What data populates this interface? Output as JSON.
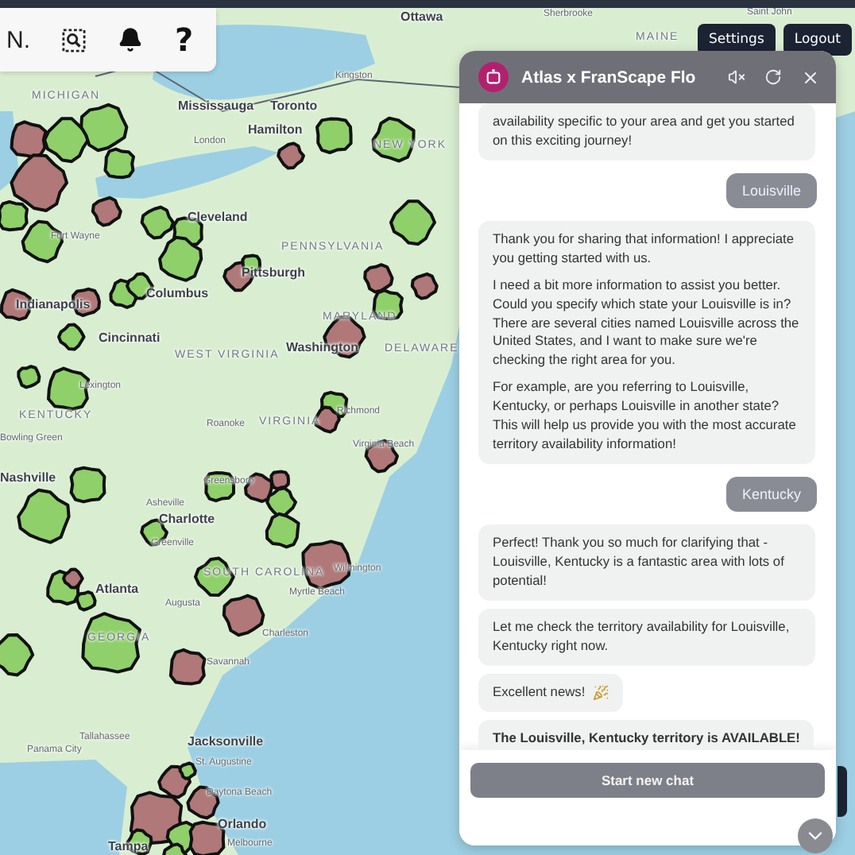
{
  "toolbar": {
    "label": "N.",
    "help": "?"
  },
  "top_buttons": [
    {
      "label": "Settings"
    },
    {
      "label": "Logout"
    }
  ],
  "map": {
    "labels": [
      {
        "text": "Ottawa",
        "kind": "city"
      },
      {
        "text": "Sherbrooke",
        "kind": "town"
      },
      {
        "text": "MAINE",
        "kind": "state"
      },
      {
        "text": "Saint John",
        "kind": "town"
      },
      {
        "text": "MICHIGAN",
        "kind": "state"
      },
      {
        "text": "Kingston",
        "kind": "town"
      },
      {
        "text": "Mississauga",
        "kind": "city"
      },
      {
        "text": "Toronto",
        "kind": "city"
      },
      {
        "text": "Hamilton",
        "kind": "city"
      },
      {
        "text": "London",
        "kind": "town"
      },
      {
        "text": "NEW YORK",
        "kind": "state"
      },
      {
        "text": "Cleveland",
        "kind": "city"
      },
      {
        "text": "Fort Wayne",
        "kind": "town"
      },
      {
        "text": "PENNSYLVANIA",
        "kind": "state"
      },
      {
        "text": "Pittsburgh",
        "kind": "city"
      },
      {
        "text": "Indianapolis",
        "kind": "city"
      },
      {
        "text": "Columbus",
        "kind": "city"
      },
      {
        "text": "Cincinnati",
        "kind": "city"
      },
      {
        "text": "MARYLAND",
        "kind": "state"
      },
      {
        "text": "Washington",
        "kind": "city"
      },
      {
        "text": "DELAWARE",
        "kind": "state"
      },
      {
        "text": "WEST VIRGINIA",
        "kind": "state"
      },
      {
        "text": "Lexington",
        "kind": "town"
      },
      {
        "text": "KENTUCKY",
        "kind": "state"
      },
      {
        "text": "Roanoke",
        "kind": "town"
      },
      {
        "text": "VIRGINIA",
        "kind": "state"
      },
      {
        "text": "Richmond",
        "kind": "town"
      },
      {
        "text": "Bowling Green",
        "kind": "town"
      },
      {
        "text": "Virginia Beach",
        "kind": "town"
      },
      {
        "text": "Nashville",
        "kind": "city"
      },
      {
        "text": "Greensboro",
        "kind": "town"
      },
      {
        "text": "Asheville",
        "kind": "town"
      },
      {
        "text": "Charlotte",
        "kind": "city"
      },
      {
        "text": "Greenville",
        "kind": "town"
      },
      {
        "text": "Wilmington",
        "kind": "town"
      },
      {
        "text": "SOUTH CAROLINA",
        "kind": "state"
      },
      {
        "text": "Atlanta",
        "kind": "city"
      },
      {
        "text": "Myrtle Beach",
        "kind": "town"
      },
      {
        "text": "Augusta",
        "kind": "town"
      },
      {
        "text": "Charleston",
        "kind": "town"
      },
      {
        "text": "GEORGIA",
        "kind": "state"
      },
      {
        "text": "Savannah",
        "kind": "town"
      },
      {
        "text": "Tallahassee",
        "kind": "town"
      },
      {
        "text": "Jacksonville",
        "kind": "city"
      },
      {
        "text": "Panama City",
        "kind": "town"
      },
      {
        "text": "St. Augustine",
        "kind": "town"
      },
      {
        "text": "Daytona Beach",
        "kind": "town"
      },
      {
        "text": "Orlando",
        "kind": "city"
      },
      {
        "text": "Melbourne",
        "kind": "town"
      },
      {
        "text": "Tampa",
        "kind": "city"
      }
    ]
  },
  "chat": {
    "title": "Atlas x FranScape Flo",
    "messages": [
      {
        "kind": "bot",
        "paragraphs": [
          "availability specific to your area and get you started on this exciting journey!"
        ]
      },
      {
        "kind": "user",
        "paragraphs": [
          "Louisville"
        ]
      },
      {
        "kind": "bot",
        "paragraphs": [
          "Thank you for sharing that information! I appreciate you getting started with us.",
          "I need a bit more information to assist you better. Could you specify which state your Louisville is in? There are several cities named Louisville across the United States, and I want to make sure we're checking the right area for you.",
          "For example, are you referring to Louisville, Kentucky, or perhaps Louisville in another state? This will help us provide you with the most accurate territory availability information!"
        ]
      },
      {
        "kind": "user",
        "paragraphs": [
          "Kentucky"
        ]
      },
      {
        "kind": "bot",
        "paragraphs": [
          "Perfect! Thank you so much for clarifying that - Louisville, Kentucky is a fantastic area with lots of potential!"
        ]
      },
      {
        "kind": "bot",
        "paragraphs": [
          "Let me check the territory availability for Louisville, Kentucky right now."
        ]
      },
      {
        "kind": "celebration",
        "paragraphs": [
          "Excellent news!"
        ]
      },
      {
        "kind": "bot",
        "paragraphs": [
          "**The Louisville, Kentucky territory is AVAILABLE!**"
        ]
      }
    ],
    "new_chat_button": "Start new chat"
  }
}
